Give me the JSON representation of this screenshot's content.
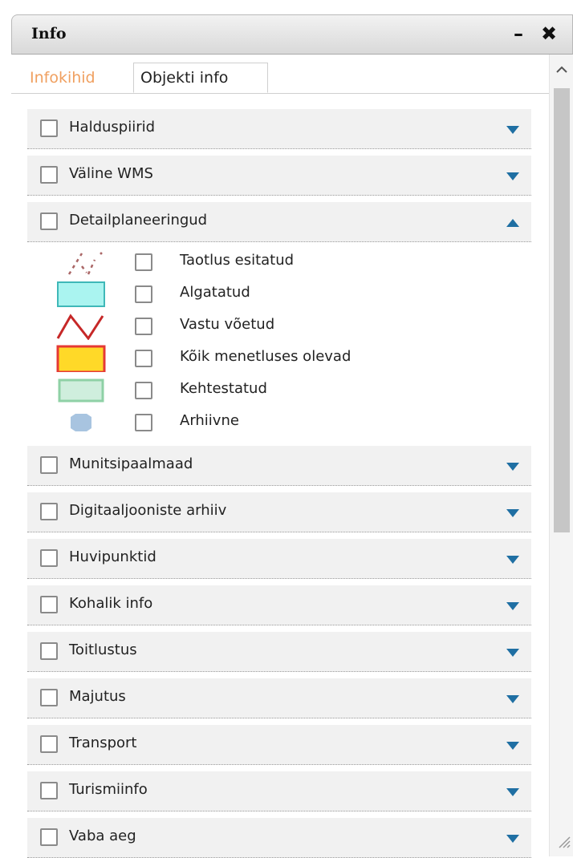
{
  "panel": {
    "title": "Info",
    "minimize_label": "–",
    "close_label": "✖"
  },
  "tabs": [
    {
      "label": "Infokihid",
      "active": true
    },
    {
      "label": "Objekti info",
      "active": false
    }
  ],
  "layers": [
    {
      "label": "Halduspiirid",
      "checked": false,
      "expanded": false
    },
    {
      "label": "Väline WMS",
      "checked": false,
      "expanded": false
    },
    {
      "label": "Detailplaneeringud",
      "checked": false,
      "expanded": true
    },
    {
      "label": "Munitsipaalmaad",
      "checked": false,
      "expanded": false
    },
    {
      "label": "Digitaaljooniste arhiiv",
      "checked": false,
      "expanded": false
    },
    {
      "label": "Huvipunktid",
      "checked": false,
      "expanded": false
    },
    {
      "label": "Kohalik info",
      "checked": false,
      "expanded": false
    },
    {
      "label": "Toitlustus",
      "checked": false,
      "expanded": false
    },
    {
      "label": "Majutus",
      "checked": false,
      "expanded": false
    },
    {
      "label": "Transport",
      "checked": false,
      "expanded": false
    },
    {
      "label": "Turismiinfo",
      "checked": false,
      "expanded": false
    },
    {
      "label": "Vaba aeg",
      "checked": false,
      "expanded": false
    }
  ],
  "sublayers": [
    {
      "label": "Taotlus esitatud",
      "symbol": "dashed-lines-symbol"
    },
    {
      "label": "Algatatud",
      "symbol": "cyan-rectangle-symbol"
    },
    {
      "label": "Vastu võetud",
      "symbol": "red-zigzag-symbol"
    },
    {
      "label": "Kõik menetluses olevad",
      "symbol": "red-yellow-rectangle-symbol"
    },
    {
      "label": "Kehtestatud",
      "symbol": "green-rectangle-symbol"
    },
    {
      "label": "Arhiivne",
      "symbol": "blue-hexagon-symbol"
    }
  ],
  "colors": {
    "accent_tab": "#f0a060",
    "arrow": "#1f6fa3",
    "row_background": "#f1f1f1"
  }
}
